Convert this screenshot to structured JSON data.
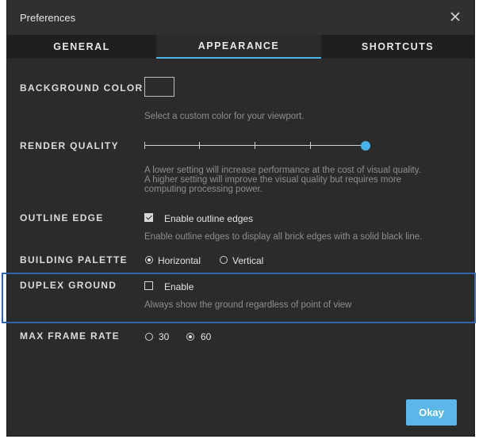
{
  "window": {
    "title": "Preferences"
  },
  "tabs": [
    {
      "label": "GENERAL",
      "active": false
    },
    {
      "label": "APPEARANCE",
      "active": true
    },
    {
      "label": "SHORTCUTS",
      "active": false
    }
  ],
  "background_color": {
    "label": "BACKGROUND COLOR",
    "help": "Select a custom color for your viewport."
  },
  "render_quality": {
    "label": "RENDER QUALITY",
    "value_fraction": 1.0,
    "steps": 5,
    "help_line1": "A lower setting will increase performance at the cost of visual quality.",
    "help_line2": "A higher setting will improve the visual quality but requires more",
    "help_line3": "computing processing power."
  },
  "outline_edge": {
    "label": "OUTLINE EDGE",
    "checkbox_label": "Enable outline edges",
    "checked": true,
    "help": "Enable outline edges to display all brick edges with a solid black line."
  },
  "building_palette": {
    "label": "BUILDING PALETTE",
    "options": [
      {
        "label": "Horizontal",
        "selected": true
      },
      {
        "label": "Vertical",
        "selected": false
      }
    ]
  },
  "duplex_ground": {
    "label": "DUPLEX GROUND",
    "checkbox_label": "Enable",
    "checked": false,
    "help": "Always show the ground regardless of point of view"
  },
  "max_frame_rate": {
    "label": "MAX FRAME RATE",
    "options": [
      {
        "label": "30",
        "selected": false
      },
      {
        "label": "60",
        "selected": true
      }
    ]
  },
  "footer": {
    "ok_label": "Okay"
  },
  "colors": {
    "accent": "#4ab3e8",
    "highlight_border": "#3065b0",
    "panel": "#2b2b2b"
  }
}
